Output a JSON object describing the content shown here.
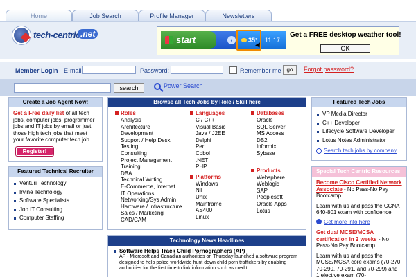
{
  "tabs": [
    {
      "label": "Home"
    },
    {
      "label": "Job Search"
    },
    {
      "label": "Profile Manager"
    },
    {
      "label": "Newsletters"
    }
  ],
  "logo": {
    "text": "tech-centric",
    "tld": ".net"
  },
  "promo": {
    "start_label": "start",
    "temperature": "35°",
    "time": "11:17",
    "headline": "Get a FREE desktop weather tool!",
    "ok_label": "OK"
  },
  "login": {
    "member_login": "Member Login",
    "email_label": "E-mail:",
    "password_label": "Password:",
    "remember_label": "Remember me",
    "go_label": "go",
    "forgot_label": "Forgot password?"
  },
  "search": {
    "button_label": "search",
    "power_search": "Power Search"
  },
  "job_agent": {
    "title_prefix": "Create a Job Agent",
    "title_now": "Now!",
    "red_text": "Get a Free daily list",
    "body": " of all tech jobs, computer jobs, programmer jobs and IT jobs by email or just those high tech jobs that meet your favorite computer tech job",
    "register_label": "Register!"
  },
  "recruiter": {
    "title": "Featured Technical Recruiter",
    "items": [
      "Venturi Technology",
      "Irvine Technology",
      "Software Specialists",
      "Job IT Consulting",
      "Computer Staffing"
    ]
  },
  "browse": {
    "title": "Browse all Tech Jobs by Role / Skill here",
    "roles": {
      "head": "Roles",
      "items": [
        "Analysis",
        "Architecture",
        "Development",
        "Support / Help Desk",
        "Testing",
        "Consulting",
        "Project Management",
        "Training",
        "DBA",
        "Technical Writing",
        "E-Commerce, Internet",
        "IT Operations",
        "Networking/Sys Admin",
        "Hardware / Infrastructure",
        "Sales / Marketing",
        "CAD/CAM"
      ]
    },
    "languages": {
      "head": "Languages",
      "items": [
        "C / C++",
        "Visual Basic",
        "Java / J2EE",
        "Delphi",
        "Perl",
        "Cobol",
        ".NET",
        "PHP"
      ]
    },
    "platforms": {
      "head": "Platforms",
      "items": [
        "Windows",
        "NT",
        "Unix",
        "Mainframe",
        "AS400",
        "Linux"
      ]
    },
    "databases": {
      "head": "Databases",
      "items": [
        "Oracle",
        "SQL Server",
        "MS Access",
        "DB2",
        "Informix",
        "Sybase"
      ]
    },
    "products": {
      "head": "Products",
      "items": [
        "Websphere",
        "Weblogic",
        "SAP",
        "Peoplesoft",
        "Oracle Apps",
        "Lotus"
      ]
    }
  },
  "news": {
    "title": "Technology News Headlines",
    "headline": "Software Helps Track Child Pornographers (AP)",
    "body": "AP - Microsoft and Canadian authorities on Thursday launched a software program designed to help police worldwide hunt down child porn traffickers by enabling authorities for the first time to link information such as credit"
  },
  "featured_jobs": {
    "title": "Featured Tech Jobs",
    "items": [
      "VP Media Director",
      "C++ Developer",
      "Lifecycle Software Developer",
      "Lotus Notes Administrator"
    ],
    "search_link": "Search tech jobs by company"
  },
  "resources": {
    "title": "Special Tech Centric Resources",
    "item1_link": "Become Cisco Certified Network Associate",
    "item1_suffix": " - No Pass-No Pay Bootcamp",
    "item1_body": "Learn with us and pass the CCNA 640-801 exam with confidence.",
    "item1_more": "Get more info here",
    "item2_link": "Get dual MCSE/MCSA certification in 2 weeks",
    "item2_suffix": " - No Pass-No Pay Bootcamp",
    "item2_body": "Learn with us and pass the MCSE/MCSA core exams (70-270, 70-290, 70-291, and 70-299) and 1 elective exam (70-"
  }
}
